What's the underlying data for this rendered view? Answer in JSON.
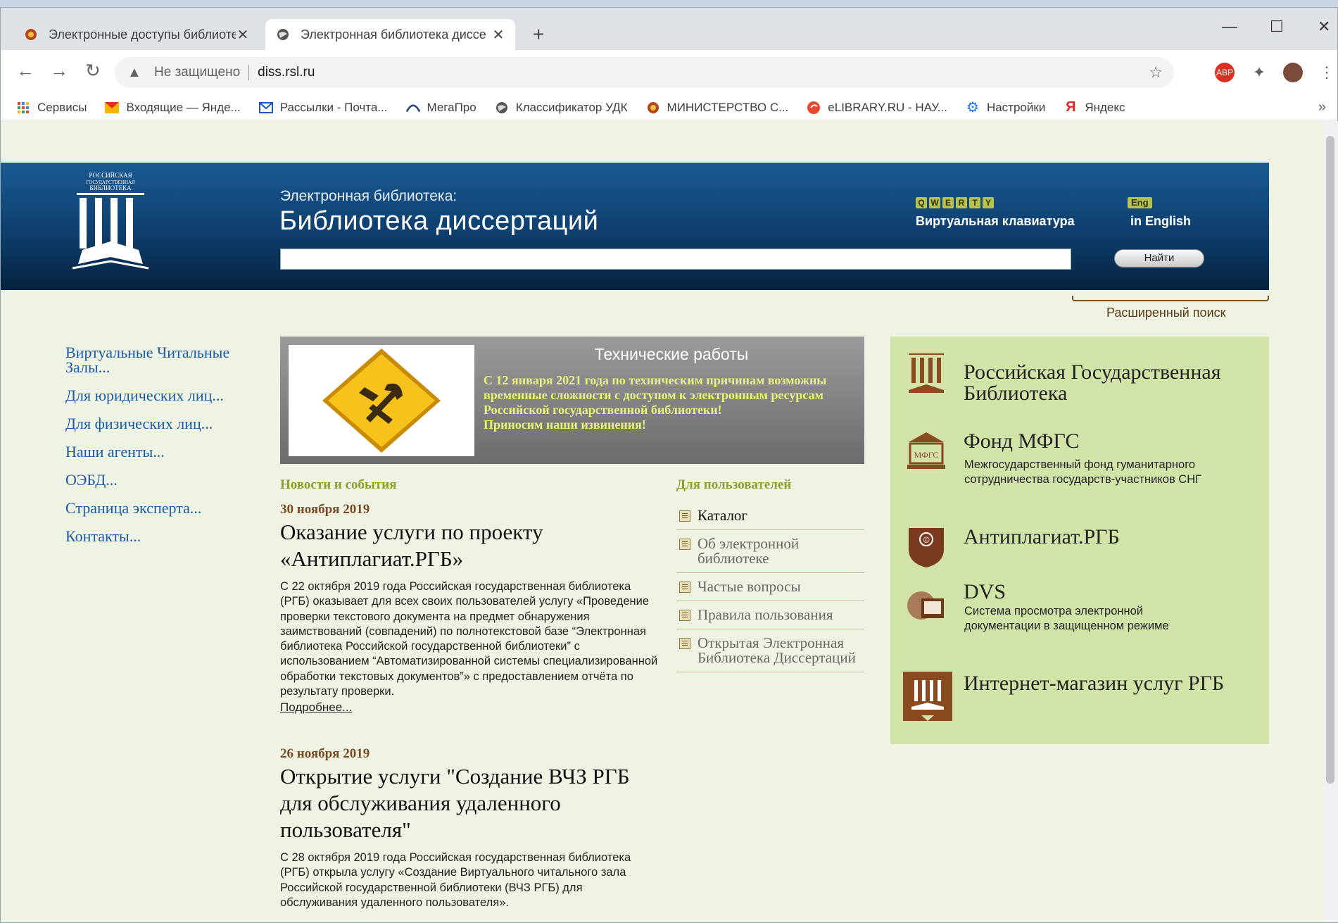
{
  "browser": {
    "tabs": [
      {
        "title": "Электронные доступы библиоте",
        "active": false
      },
      {
        "title": "Электронная библиотека диссе",
        "active": true
      }
    ],
    "new_tab_symbol": "+",
    "window_controls": [
      "—",
      "☐",
      "✕"
    ],
    "security_label": "Не защищено",
    "url": "diss.rsl.ru",
    "bookmarks": [
      {
        "label": "Сервисы",
        "icon": "apps-grid-icon"
      },
      {
        "label": "Входящие — Янде...",
        "icon": "mail-icon"
      },
      {
        "label": "Рассылки - Почта...",
        "icon": "mail-outline-icon"
      },
      {
        "label": "МегаПро",
        "icon": "megapro-icon"
      },
      {
        "label": "Классификатор УДК",
        "icon": "globe-icon"
      },
      {
        "label": "МИНИСТЕРСТВО С...",
        "icon": "emblem-icon"
      },
      {
        "label": "eLIBRARY.RU - НАУ...",
        "icon": "elibrary-icon"
      },
      {
        "label": "Настройки",
        "icon": "gear-icon"
      },
      {
        "label": "Яндекс",
        "icon": "yandex-icon"
      }
    ],
    "bookmarks_more": "»"
  },
  "header": {
    "logo_text": "РОССИЙСКАЯ ГОСУДАРСТВЕННАЯ БИБЛИОТЕКА",
    "subtitle": "Электронная библиотека:",
    "title": "Библиотека диссертаций",
    "search_button": "Найти",
    "virtual_keyboard_keys": [
      "Q",
      "W",
      "E",
      "R",
      "T",
      "Y"
    ],
    "virtual_keyboard_label": "Виртуальная клавиатура",
    "eng_badge": "Eng",
    "english_label": "in English",
    "advanced_search": "Расширенный поиск"
  },
  "left_nav": [
    "Виртуальные Читальные Залы...",
    "Для юридических лиц...",
    "Для физических лиц...",
    "Наши агенты...",
    "ОЭБД...",
    "Страница эксперта...",
    "Контакты..."
  ],
  "notice": {
    "title": "Технические работы",
    "body": "С 12 января 2021 года по техническим причинам возможны временные сложности с доступом к электронным ресурсам Российской государственной библиотеки!",
    "apology": "Приносим наши извинения!"
  },
  "news": {
    "heading": "Новости и события",
    "items": [
      {
        "date": "30 ноября 2019",
        "title": "Оказание услуги по проекту «Антиплагиат.РГБ»",
        "body": "С 22 октября 2019 года Российская государственная библиотека (РГБ) оказывает для всех своих пользователей услугу «Проведение проверки текстового документа на предмет обнаружения заимствований (совпадений) по полнотекстовой базе “Электронная библиотека Российской государственной библиотеки” с использованием “Автоматизированной системы специализированной обработки текстовых документов”» с предоставлением отчёта по результату проверки.",
        "more": "Подробнее..."
      },
      {
        "date": "26 ноября 2019",
        "title": "Открытие услуги \"Создание ВЧЗ РГБ для обслуживания удаленного пользователя\"",
        "body": "С 28 октября 2019 года Российская государственная библиотека (РГБ) открыла услугу «Создание Виртуального читального зала Российской государственной библиотеки (ВЧЗ РГБ) для обслуживания удаленного пользователя».",
        "more": ""
      }
    ]
  },
  "users": {
    "heading": "Для пользователей",
    "items": [
      "Каталог",
      "Об электронной библиотеке",
      "Частые вопросы",
      "Правила пользования",
      "Открытая Электронная Библиотека Диссертаций"
    ]
  },
  "right_panel": [
    {
      "title": "Российская Государственная Библиотека",
      "desc": "",
      "icon": "rgb-logo-icon"
    },
    {
      "title": "Фонд МФГС",
      "desc": "Межгосударственный фонд гуманитарного сотрудничества государств-участников СНГ",
      "icon": "mfgs-building-icon",
      "icon_text": "МФГС"
    },
    {
      "title": "Антиплагиат.РГБ",
      "desc": "",
      "icon": "antiplagiat-shield-icon",
      "icon_text": "©"
    },
    {
      "title": "DVS",
      "desc": "Система просмотра электронной документации в защищенном режиме",
      "icon": "dvs-viewer-icon"
    },
    {
      "title": "Интернет-магазин услуг РГБ",
      "desc": "",
      "icon": "shop-rgb-icon"
    }
  ],
  "colors": {
    "header_top": "#1a5a93",
    "header_bottom": "#06233f",
    "page_bg": "#eef3e4",
    "nav_link": "#1d5aa6",
    "section_heading": "#8aa028",
    "date": "#7a4b22",
    "right_panel_bg": "#d2e3a8",
    "notice_text": "#e9f07a"
  }
}
